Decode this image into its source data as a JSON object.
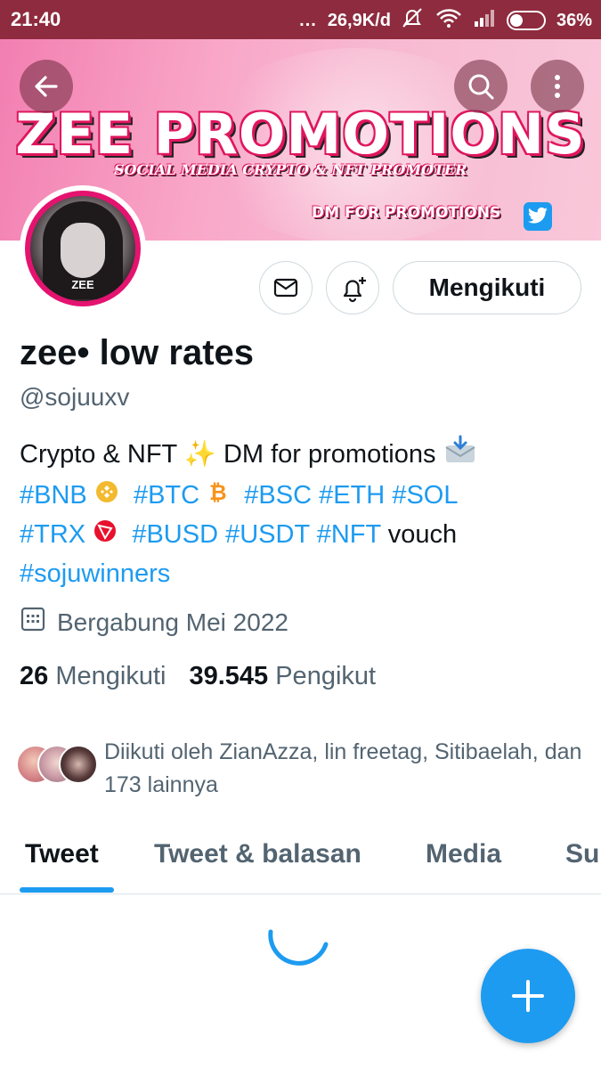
{
  "status_bar": {
    "time": "21:40",
    "network_speed": "26,9K/d",
    "battery": "36%",
    "more": "..."
  },
  "banner": {
    "title": "ZEE PROMOTIONS",
    "subtitle": "SOCIAL MEDIA CRYPTO & NFT PROMOTER",
    "dm_text": "DM FOR PROMOTIONS",
    "avatar_text": "ZEE",
    "colors": {
      "banner_pink": "#f27fb1",
      "avatar_ring": "#e4136f"
    }
  },
  "header_actions": {
    "back_icon": "arrow-left-icon",
    "search_icon": "search-icon",
    "more_icon": "more-vertical-icon"
  },
  "profile": {
    "display_name": "zee• low rates",
    "handle": "@sojuuxv",
    "follow_button_label": "Mengikuti",
    "bio": {
      "line1_text": "Crypto & NFT ✨ DM for promotions",
      "line1_emoji": "📩",
      "tags_line2": [
        "#BNB",
        "#BTC",
        "#BSC",
        "#ETH",
        "#SOL"
      ],
      "tags_line3": [
        "#TRX",
        "#BUSD",
        "#USDT",
        "#NFT"
      ],
      "line3_suffix": "vouch",
      "tag_line4": "#sojuwinners"
    },
    "joined": "Bergabung Mei 2022",
    "following_count": "26",
    "following_label": "Mengikuti",
    "followers_count": "39.545",
    "followers_label": "Pengikut",
    "followed_by": "Diikuti oleh ZianAzza, lin freetag, Sitibaelah, dan 173 lainnya"
  },
  "tabs": [
    {
      "label": "Tweet",
      "active": true
    },
    {
      "label": "Tweet & balasan",
      "active": false
    },
    {
      "label": "Media",
      "active": false
    },
    {
      "label": "Su",
      "active": false
    }
  ],
  "accent_color": "#1d9bf0"
}
